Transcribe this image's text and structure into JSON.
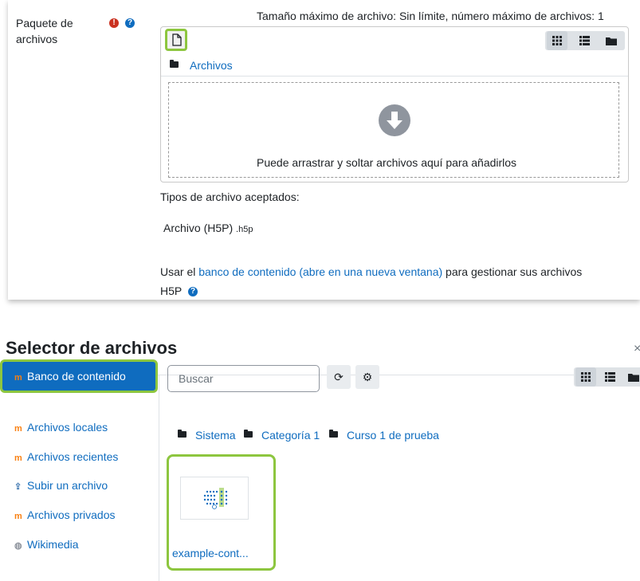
{
  "form": {
    "field_label_line1": "Paquete de",
    "field_label_line2": "archivos",
    "required_icon": "exclamation-icon",
    "help_icon": "question-icon",
    "max_size_text": "Tamaño máximo de archivo: Sin límite, número máximo de archivos: 1",
    "folder_label": "Archivos",
    "drop_text": "Puede arrastrar y soltar archivos aquí para añadirlos",
    "accepted_types_label": "Tipos de archivo aceptados:",
    "accepted_type_name": "Archivo (H5P)",
    "accepted_type_ext": ".h5p",
    "content_bank_prefix": "Usar el ",
    "content_bank_link": "banco de contenido (abre en una nueva ventana)",
    "content_bank_suffix": " para gestionar sus archivos",
    "content_bank_line2": "H5P"
  },
  "picker": {
    "title": "Selector de archivos",
    "close": "×",
    "sidebar": [
      {
        "label": "Banco de contenido",
        "icon": "moodle-icon",
        "active": true
      },
      {
        "label": "Archivos locales",
        "icon": "moodle-icon"
      },
      {
        "label": "Archivos recientes",
        "icon": "moodle-icon"
      },
      {
        "label": "Subir un archivo",
        "icon": "upload-icon"
      },
      {
        "label": "Archivos privados",
        "icon": "moodle-icon"
      },
      {
        "label": "Wikimedia",
        "icon": "wikimedia-icon"
      }
    ],
    "search_placeholder": "Buscar",
    "breadcrumb": [
      "Sistema",
      "Categoría 1",
      "Curso 1 de prueba"
    ],
    "file_name": "example-cont..."
  },
  "colors": {
    "accent": "#0f6cbf",
    "highlight": "#8dc63f",
    "required": "#ca3120"
  }
}
